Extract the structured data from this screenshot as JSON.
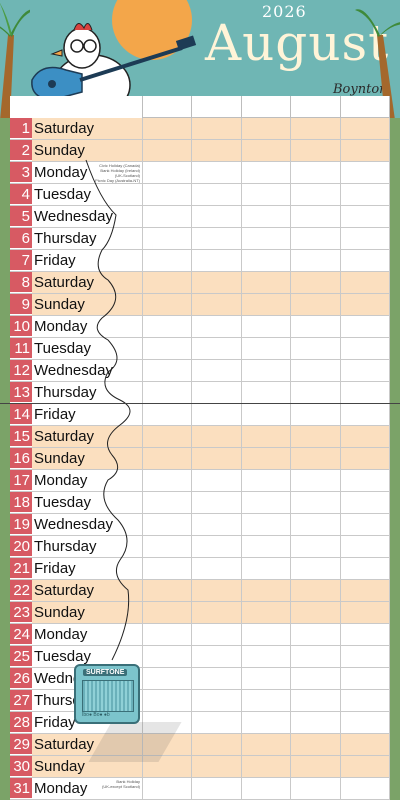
{
  "header": {
    "year": "2026",
    "month": "August",
    "signature": "Boynton"
  },
  "amp": {
    "brand": "SURFTONE",
    "knobs": "Ibo● Bo● ●b"
  },
  "days": [
    {
      "num": "1",
      "name": "Saturday",
      "weekend": true,
      "note": ""
    },
    {
      "num": "2",
      "name": "Sunday",
      "weekend": true,
      "note": ""
    },
    {
      "num": "3",
      "name": "Monday",
      "weekend": false,
      "note": "Civic Holiday (Canada)\nBank Holiday (Ireland)\n(UK-Scotland)\nPicnic Day (Australia-NT)"
    },
    {
      "num": "4",
      "name": "Tuesday",
      "weekend": false,
      "note": ""
    },
    {
      "num": "5",
      "name": "Wednesday",
      "weekend": false,
      "note": ""
    },
    {
      "num": "6",
      "name": "Thursday",
      "weekend": false,
      "note": ""
    },
    {
      "num": "7",
      "name": "Friday",
      "weekend": false,
      "note": ""
    },
    {
      "num": "8",
      "name": "Saturday",
      "weekend": true,
      "note": ""
    },
    {
      "num": "9",
      "name": "Sunday",
      "weekend": true,
      "note": ""
    },
    {
      "num": "10",
      "name": "Monday",
      "weekend": false,
      "note": ""
    },
    {
      "num": "11",
      "name": "Tuesday",
      "weekend": false,
      "note": ""
    },
    {
      "num": "12",
      "name": "Wednesday",
      "weekend": false,
      "note": ""
    },
    {
      "num": "13",
      "name": "Thursday",
      "weekend": false,
      "note": ""
    },
    {
      "num": "14",
      "name": "Friday",
      "weekend": false,
      "note": ""
    },
    {
      "num": "15",
      "name": "Saturday",
      "weekend": true,
      "note": ""
    },
    {
      "num": "16",
      "name": "Sunday",
      "weekend": true,
      "note": ""
    },
    {
      "num": "17",
      "name": "Monday",
      "weekend": false,
      "note": ""
    },
    {
      "num": "18",
      "name": "Tuesday",
      "weekend": false,
      "note": ""
    },
    {
      "num": "19",
      "name": "Wednesday",
      "weekend": false,
      "note": ""
    },
    {
      "num": "20",
      "name": "Thursday",
      "weekend": false,
      "note": ""
    },
    {
      "num": "21",
      "name": "Friday",
      "weekend": false,
      "note": ""
    },
    {
      "num": "22",
      "name": "Saturday",
      "weekend": true,
      "note": ""
    },
    {
      "num": "23",
      "name": "Sunday",
      "weekend": true,
      "note": ""
    },
    {
      "num": "24",
      "name": "Monday",
      "weekend": false,
      "note": ""
    },
    {
      "num": "25",
      "name": "Tuesday",
      "weekend": false,
      "note": ""
    },
    {
      "num": "26",
      "name": "Wednesday",
      "weekend": false,
      "note": ""
    },
    {
      "num": "27",
      "name": "Thursday",
      "weekend": false,
      "note": ""
    },
    {
      "num": "28",
      "name": "Friday",
      "weekend": false,
      "note": ""
    },
    {
      "num": "29",
      "name": "Saturday",
      "weekend": true,
      "note": ""
    },
    {
      "num": "30",
      "name": "Sunday",
      "weekend": true,
      "note": ""
    },
    {
      "num": "31",
      "name": "Monday",
      "weekend": false,
      "note": "Bank Holiday\n(UK-except Scotland)"
    }
  ],
  "columns": 5,
  "colors": {
    "header_bg": "#6fb6b4",
    "day_number_bg": "#d75a63",
    "weekend_bg": "#fbdfbf",
    "border_green": "#7ba368",
    "sun": "#f3a64a"
  }
}
